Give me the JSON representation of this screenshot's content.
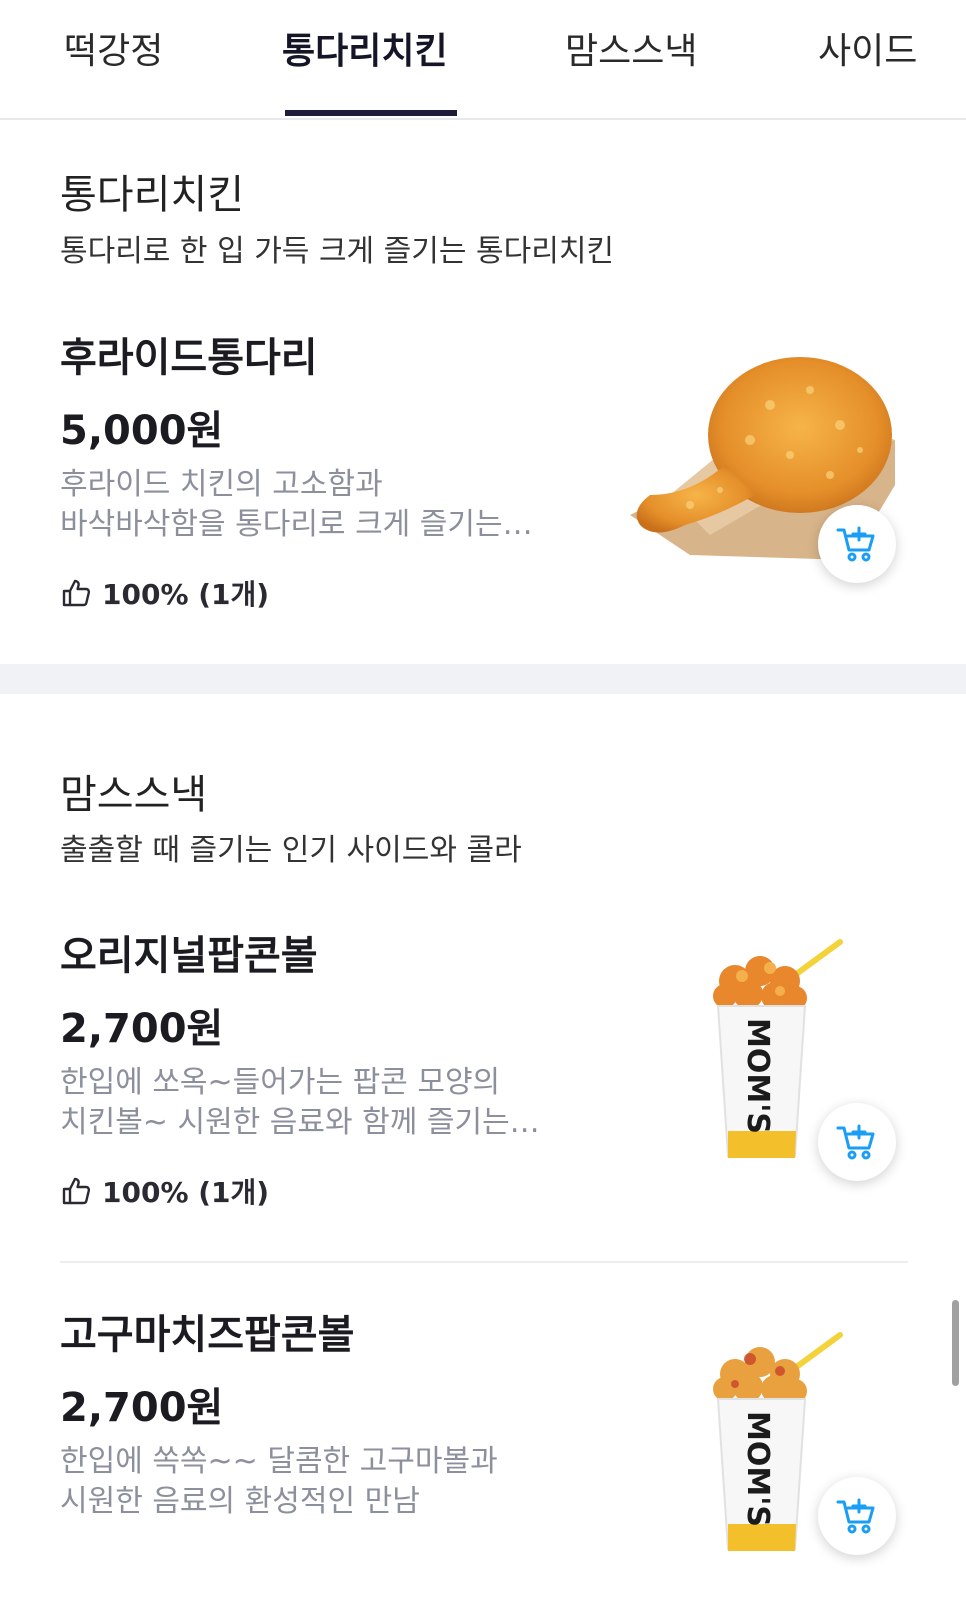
{
  "tabs": [
    {
      "label": "떡강정"
    },
    {
      "label": "통다리치킨"
    },
    {
      "label": "맘스스낵"
    },
    {
      "label": "사이드"
    }
  ],
  "sections": [
    {
      "title": "통다리치킨",
      "description": "통다리로 한 입 가득 크게 즐기는 통다리치킨",
      "items": [
        {
          "name": "후라이드통다리",
          "price": "5,000원",
          "desc_lines": [
            "후라이드 치킨의 고소함과",
            "바삭바삭함을 통다리로 크게 즐기는…"
          ],
          "rating": "100% (1개)",
          "image": "fried-chicken-drumstick"
        }
      ]
    },
    {
      "title": "맘스스낵",
      "description": "출출할 때 즐기는 인기 사이드와 콜라",
      "items": [
        {
          "name": "오리지널팝콘볼",
          "price": "2,700원",
          "desc_lines": [
            "한입에 쏘옥~들어가는 팝콘 모양의",
            "치킨볼~ 시원한 음료와 함께 즐기는…"
          ],
          "rating": "100% (1개)",
          "image": "popcorn-chicken-cup",
          "cup_text": "MOM'S"
        },
        {
          "name": "고구마치즈팝콘볼",
          "price": "2,700원",
          "desc_lines": [
            "한입에 쏙쏙~~ 달콤한 고구마볼과",
            "시원한 음료의 환성적인 만남"
          ],
          "image": "sweet-potato-popcorn-cup",
          "cup_text": "MOM'S"
        }
      ]
    }
  ],
  "icons": {
    "rating": "thumbs-up-icon",
    "cart": "add-to-cart-icon"
  },
  "colors": {
    "accent": "#1a9ef5",
    "tab_indicator": "#1d1b3a",
    "muted_text": "#8c8f9c"
  }
}
